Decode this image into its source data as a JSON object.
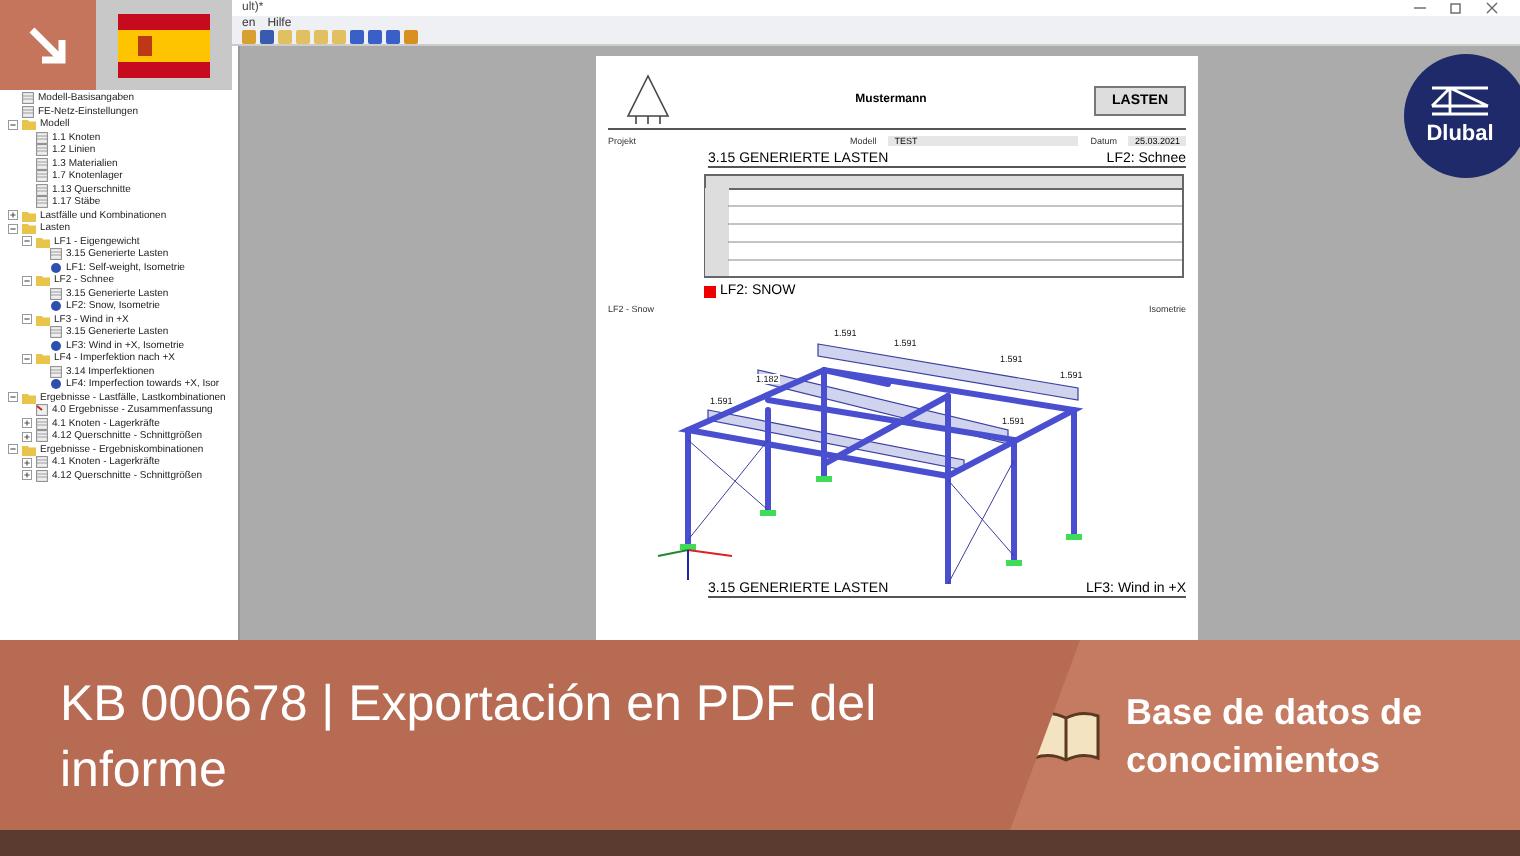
{
  "window": {
    "title": "ult)*"
  },
  "menu": [
    "en",
    "Hilfe"
  ],
  "tree": [
    {
      "label": "Modell-Basisangaben",
      "kind": "doc"
    },
    {
      "label": "FE-Netz-Einstellungen",
      "kind": "doc"
    },
    {
      "label": "Modell",
      "kind": "folder",
      "expanded": true,
      "children": [
        {
          "label": "1.1 Knoten",
          "kind": "doc"
        },
        {
          "label": "1.2 Linien",
          "kind": "doc"
        },
        {
          "label": "1.3 Materialien",
          "kind": "doc"
        },
        {
          "label": "1.7 Knotenlager",
          "kind": "doc"
        },
        {
          "label": "1.13 Querschnitte",
          "kind": "doc"
        },
        {
          "label": "1.17 Stäbe",
          "kind": "doc"
        }
      ]
    },
    {
      "label": "Lastfälle und Kombinationen",
      "kind": "folder",
      "expanded": false
    },
    {
      "label": "Lasten",
      "kind": "folder",
      "expanded": true,
      "children": [
        {
          "label": "LF1 - Eigengewicht",
          "kind": "folder",
          "expanded": true,
          "children": [
            {
              "label": "3.15 Generierte Lasten",
              "kind": "doc"
            },
            {
              "label": "LF1: Self-weight, Isometrie",
              "kind": "picture"
            }
          ]
        },
        {
          "label": "LF2 - Schnee",
          "kind": "folder",
          "expanded": true,
          "children": [
            {
              "label": "3.15 Generierte Lasten",
              "kind": "doc"
            },
            {
              "label": "LF2: Snow, Isometrie",
              "kind": "picture"
            }
          ]
        },
        {
          "label": "LF3 - Wind in +X",
          "kind": "folder",
          "expanded": true,
          "children": [
            {
              "label": "3.15 Generierte Lasten",
              "kind": "doc"
            },
            {
              "label": "LF3: Wind in +X, Isometrie",
              "kind": "picture"
            }
          ]
        },
        {
          "label": "LF4 - Imperfektion nach +X",
          "kind": "folder",
          "expanded": true,
          "children": [
            {
              "label": "3.14 Imperfektionen",
              "kind": "doc"
            },
            {
              "label": "LF4: Imperfection towards +X, Isor",
              "kind": "picture"
            }
          ]
        }
      ]
    },
    {
      "label": "Ergebnisse - Lastfälle, Lastkombinationen",
      "kind": "folder",
      "expanded": true,
      "children": [
        {
          "label": "4.0 Ergebnisse - Zusammenfassung",
          "kind": "results"
        },
        {
          "label": "4.1 Knoten - Lagerkräfte",
          "kind": "doc",
          "expanded": false
        },
        {
          "label": "4.12 Querschnitte - Schnittgrößen",
          "kind": "doc",
          "expanded": false
        }
      ]
    },
    {
      "label": "Ergebnisse - Ergebniskombinationen",
      "kind": "folder",
      "expanded": true,
      "children": [
        {
          "label": "4.1 Knoten - Lagerkräfte",
          "kind": "doc",
          "expanded": false
        },
        {
          "label": "4.12 Querschnitte - Schnittgrößen",
          "kind": "doc",
          "expanded": false
        }
      ]
    }
  ],
  "report": {
    "company": "Mustermann",
    "header_box": "LASTEN",
    "project_label": "Projekt",
    "model_label": "Modell",
    "model": "TEST",
    "date_label": "Datum",
    "date": "25.03.2021",
    "sections": [
      {
        "heading": "3.15 GENERIERTE LASTEN",
        "case": "LF2: Schnee"
      }
    ],
    "figure": {
      "title": "LF2: SNOW",
      "caption": "LF2 - Snow",
      "view": "Isometrie",
      "load_values": [
        "1.591",
        "1.591",
        "1.591",
        "1.591",
        "1.182",
        "1.591",
        "1.591"
      ]
    },
    "next_section": {
      "heading": "3.15 GENERIERTE LASTEN",
      "case": "LF3: Wind in +X"
    }
  },
  "banner": {
    "title": "KB 000678 | Exportación en PDF del informe",
    "category": "Base de datos de conocimientos"
  },
  "logo": {
    "text": "Dlubal"
  }
}
